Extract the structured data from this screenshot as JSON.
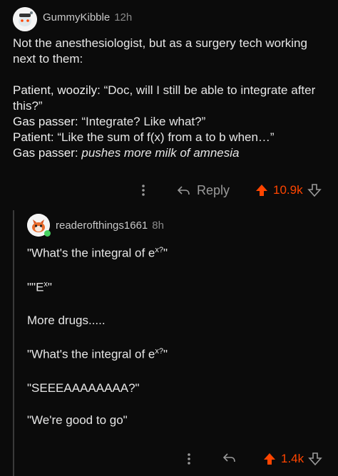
{
  "comment1": {
    "username": "GummyKibble",
    "time": "12h",
    "intro_line1": "Not the anesthesiologist, but as a surgery tech working",
    "intro_line2": "next to them:",
    "line1_speaker": "Patient, woozily:",
    "line1_text": " “Doc, will I still be able to integrate after",
    "line1_cont": "this?”",
    "line2_speaker": "Gas passer:",
    "line2_text": " “Integrate? Like what?”",
    "line3_speaker": "Patient:",
    "line3_text": " “Like the sum of f(x) from a to b when…”",
    "line4_speaker": "Gas passer:",
    "line4_text": " pushes more milk of amnesia",
    "reply_label": "Reply",
    "score": "10.9k"
  },
  "comment2": {
    "username": "readerofthings1661",
    "time": "8h",
    "l1_prefix": "\"What's the integral of e",
    "l1_sup": "x?",
    "l1_suffix": "\"",
    "l2_prefix": "\"\"E",
    "l2_sup": "x",
    "l2_suffix": "\"",
    "l3": "More drugs.....",
    "l4_prefix": "\"What's the integral of e",
    "l4_sup": "x?",
    "l4_suffix": "\"",
    "l5": "\"SEEEAAAAAAAA?\"",
    "l6": "\"We're good to go\"",
    "score": "1.4k"
  },
  "colors": {
    "background": "#0b0b0b",
    "upvote": "#ff4500",
    "muted": "#9a9a9a"
  }
}
